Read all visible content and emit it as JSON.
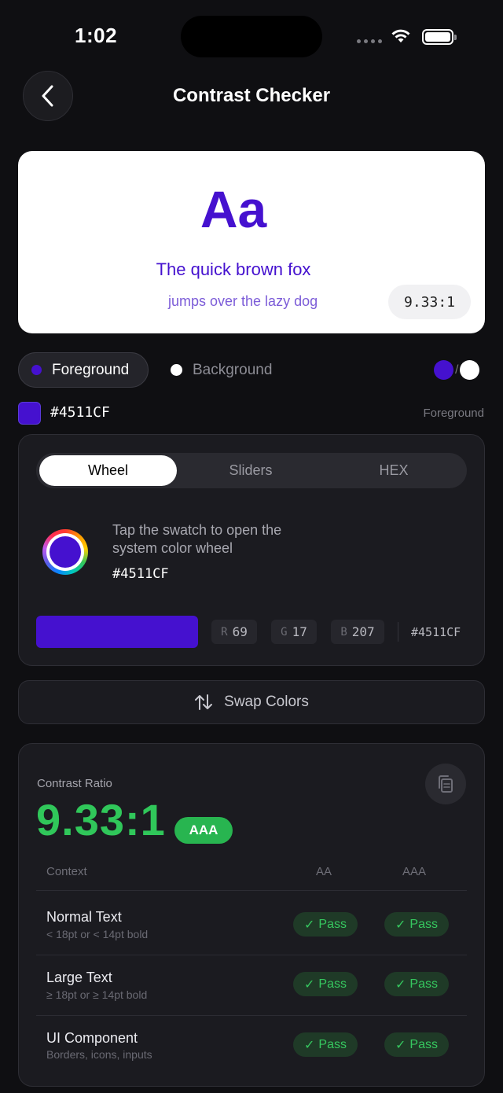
{
  "status_bar": {
    "time": "1:02"
  },
  "header": {
    "title": "Contrast Checker",
    "back_icon": "chevron-left-icon"
  },
  "preview": {
    "sample_large": "Aa",
    "sample_line1": "The quick brown fox",
    "sample_line2": "jumps over the lazy dog",
    "ratio": "9.33:1",
    "text_color": "#4511CF",
    "background_color": "#FFFFFF"
  },
  "target_selector": {
    "foreground_label": "Foreground",
    "background_label": "Background",
    "pair_separator": "/"
  },
  "current_color": {
    "hex": "#4511CF",
    "target": "Foreground"
  },
  "picker": {
    "tabs": [
      "Wheel",
      "Sliders",
      "HEX"
    ],
    "active_tab": "Wheel",
    "instructions": "Tap the swatch to open the system color wheel",
    "hex": "#4511CF",
    "rgb": [
      {
        "key": "R",
        "value": "69"
      },
      {
        "key": "G",
        "value": "17"
      },
      {
        "key": "B",
        "value": "207"
      }
    ],
    "hex_readout": "#4511CF"
  },
  "swap": {
    "label": "Swap Colors"
  },
  "result": {
    "label": "Contrast Ratio",
    "ratio": "9.33:1",
    "badge": "AAA",
    "columns": [
      "Context",
      "AA",
      "AAA"
    ],
    "rows": [
      {
        "title": "Normal Text",
        "subtitle": "< 18pt  or  < 14pt bold",
        "aa": "Pass",
        "aaa": "Pass"
      },
      {
        "title": "Large Text",
        "subtitle": "≥ 18pt  or  ≥ 14pt bold",
        "aa": "Pass",
        "aaa": "Pass"
      },
      {
        "title": "UI Component",
        "subtitle": "Borders, icons, inputs",
        "aa": "Pass",
        "aaa": "Pass"
      }
    ]
  },
  "colors": {
    "accent": "#4511CF",
    "pass_green": "#30C75A"
  }
}
